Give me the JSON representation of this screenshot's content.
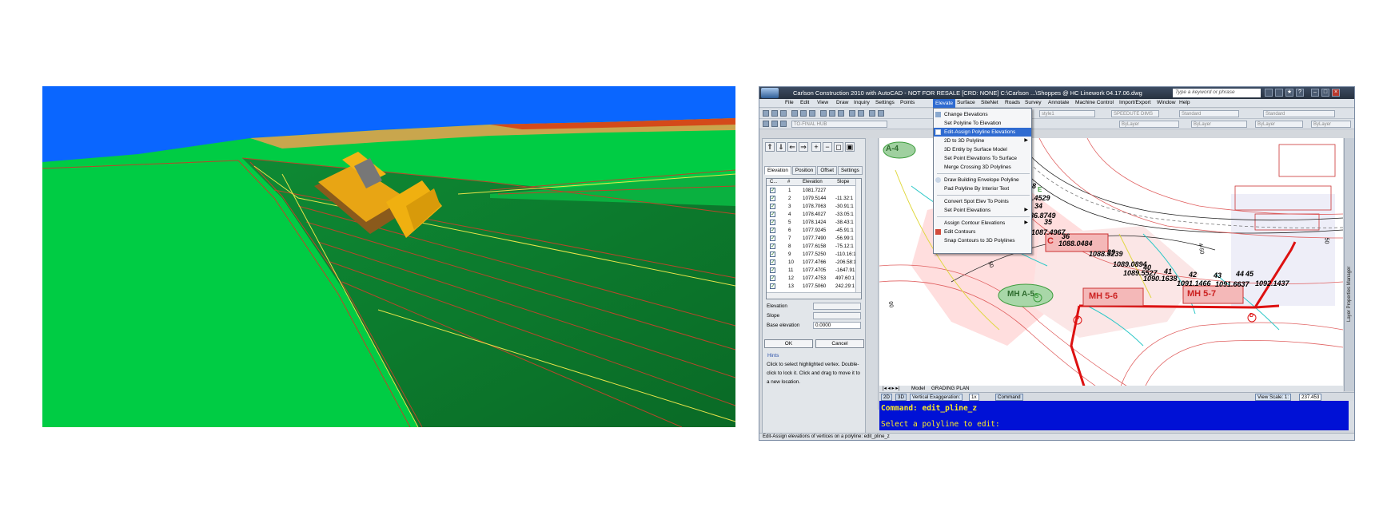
{
  "scene": {
    "label": "3D view with bulldozer"
  },
  "app": {
    "title": "Carlson Construction 2010 with AutoCAD - NOT FOR RESALE [CRD: NONE]   C:\\Carlson ...\\Shoppes @ HC Linework 04.17.06.dwg",
    "search_placeholder": "Type a keyword or phrase",
    "menus": [
      "File",
      "Edit",
      "View",
      "Draw",
      "Inquiry",
      "Settings",
      "Points",
      "Elevate",
      "Surface",
      "SiteNet",
      "Roads",
      "Survey",
      "Annotate",
      "Machine Control",
      "Import/Export",
      "Window",
      "Help"
    ],
    "active_menu": "Elevate",
    "toolbar": {
      "style_combo": "style1",
      "dim_combo": "SPEEDUTE DIMS",
      "text_combo": "Standard",
      "table_combo": "Standard",
      "layer_combo": "TO-FINAL HUB",
      "bylayer1": "ByLayer",
      "bylayer2": "ByLayer",
      "bylayer3": "ByLayer",
      "bycolor": "ByLayer"
    },
    "elevate_menu": [
      {
        "label": "Change Elevations",
        "sub": false
      },
      {
        "label": "Set Polyline To Elevation",
        "sub": false
      },
      {
        "label": "Edit-Assign Polyline Elevations",
        "sub": false,
        "highlight": true
      },
      {
        "label": "2D to 3D Polyline",
        "sub": true
      },
      {
        "label": "3D Entity by Surface Model",
        "sub": false
      },
      {
        "label": "Set Point Elevations To Surface",
        "sub": false
      },
      {
        "label": "Merge Crossing 3D Polylines",
        "sub": false
      },
      {
        "label": "Draw Building Envelope Polyline",
        "sub": false
      },
      {
        "label": "Pad Polyline By Interior Text",
        "sub": false
      },
      {
        "label": "Convert Spot Elev To Points",
        "sub": false
      },
      {
        "label": "Set Point Elevations",
        "sub": true
      },
      {
        "label": "Assign Contour Elevations",
        "sub": true
      },
      {
        "label": "Edit Contours",
        "sub": false
      },
      {
        "label": "Snap Contours to 3D Polylines",
        "sub": false
      }
    ],
    "panel": {
      "tabs": [
        "Elevation",
        "Position",
        "Offset",
        "Settings"
      ],
      "columns": [
        "C...",
        "#",
        "Elevation",
        "Slope"
      ],
      "rows": [
        {
          "n": "1",
          "elev": "1081.7227",
          "slope": ""
        },
        {
          "n": "2",
          "elev": "1079.5144",
          "slope": "-11.32:1"
        },
        {
          "n": "3",
          "elev": "1078.7063",
          "slope": "-30.91:1"
        },
        {
          "n": "4",
          "elev": "1078.4027",
          "slope": "-33.05:1"
        },
        {
          "n": "5",
          "elev": "1078.1424",
          "slope": "-38.43:1"
        },
        {
          "n": "6",
          "elev": "1077.9245",
          "slope": "-45.91:1"
        },
        {
          "n": "7",
          "elev": "1077.7490",
          "slope": "-56.99:1"
        },
        {
          "n": "8",
          "elev": "1077.6158",
          "slope": "-75.12:1"
        },
        {
          "n": "9",
          "elev": "1077.5250",
          "slope": "-110.16:1"
        },
        {
          "n": "10",
          "elev": "1077.4766",
          "slope": "-206.58:1"
        },
        {
          "n": "11",
          "elev": "1077.4705",
          "slope": "-1647.91:1"
        },
        {
          "n": "12",
          "elev": "1077.4753",
          "slope": "497.60:1"
        },
        {
          "n": "13",
          "elev": "1077.5060",
          "slope": "242.29:1"
        }
      ],
      "elevation_label": "Elevation",
      "slope_label": "Slope",
      "base_elevation_label": "Base elevation",
      "base_elevation_value": "0.0000",
      "ok": "OK",
      "cancel": "Cancel",
      "hints_label": "Hints",
      "hints": "Click to select highlighted vertex. Double-click to lock it. Click and drag to move it to a new location."
    },
    "drawing": {
      "labels": {
        "a4": "A-4",
        "mh_a5": "MH A-5",
        "mh_56": "MH 5-6",
        "mh_57": "MH 5-7",
        "c": "C",
        "s": "S",
        "d1": "D",
        "d2": "D",
        "e": "E",
        "v1": "1086.8749",
        "v2": "1087.4967",
        "v3": "1088.0484",
        "v4": "1088.5239",
        "v5": "1089.0894",
        "v6": "1089.5527",
        "v7": "1090.1638",
        "v8": "1091.1466",
        "v9": "1091.6637",
        "v10": "1092.1437",
        "v0": "86.4529",
        "n08": "08",
        "n34": "34",
        "n35": "35",
        "n36": "36",
        "n38": "38",
        "n39": "39",
        "n40": "40",
        "n41": "41",
        "n42": "42",
        "n43": "43",
        "n44": "44",
        "n45": "45",
        "c50a": "50",
        "c50b": "4-50",
        "c00": "00",
        "c50c": "50"
      },
      "model_tab": "Model",
      "layout_tab": "GRADING PLAN",
      "side_palette": "Layer Properties Manager"
    },
    "status": {
      "btn_2d": "2D",
      "btn_3d": "3D",
      "vert_exag_label": "Vertical Exaggeration:",
      "vert_exag_value": "1x",
      "command_btn": "Command",
      "view_scale_label": "View Scale: 1:",
      "view_scale_value": "237.453"
    },
    "command": {
      "line1": "Command: edit_pline_z",
      "line2": "Select a polyline to edit:"
    },
    "statusbar": "Edit-Assign elevations of vertices on a polyline: edit_pline_z"
  }
}
